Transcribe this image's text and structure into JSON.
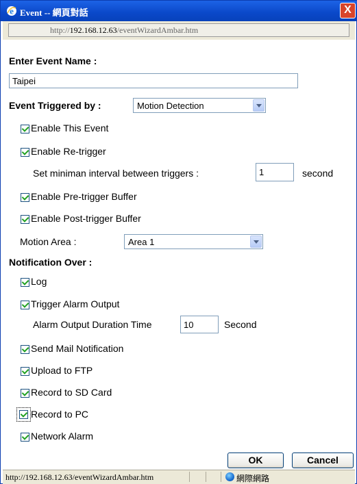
{
  "window": {
    "title": "Event -- 網頁對話",
    "close_label": "X",
    "url_prefix": "http://",
    "url_host": "192.168.12.63",
    "url_path": "/eventWizardAmbar.htm"
  },
  "event_name": {
    "label": "Enter Event Name :",
    "value": "Taipei"
  },
  "trigger": {
    "label": "Event Triggered by :",
    "selected": "Motion Detection"
  },
  "options": {
    "enable_event": "Enable This Event",
    "enable_retrigger": "Enable Re-trigger",
    "interval_label": "Set miniman interval between triggers :",
    "interval_value": "1",
    "interval_unit": "second",
    "pre_buffer": "Enable Pre-trigger Buffer",
    "post_buffer": "Enable Post-trigger Buffer",
    "motion_area_label": "Motion Area :",
    "motion_area_selected": "Area 1"
  },
  "notification": {
    "label": "Notification Over :",
    "log": "Log",
    "alarm_output": "Trigger Alarm Output",
    "duration_label": "Alarm Output Duration Time",
    "duration_value": "10",
    "duration_unit": "Second",
    "send_mail": "Send Mail Notification",
    "upload_ftp": "Upload to FTP",
    "record_sd": "Record to SD Card",
    "record_pc": "Record to PC",
    "network_alarm": "Network Alarm"
  },
  "buttons": {
    "ok": "OK",
    "cancel": "Cancel"
  },
  "statusbar": {
    "url": "http://192.168.12.63/eventWizardAmbar.htm",
    "zone": "網際網路"
  },
  "colors": {
    "titlebar": "#0a48c9",
    "checkmark": "#21a121",
    "close": "#d9442a"
  }
}
